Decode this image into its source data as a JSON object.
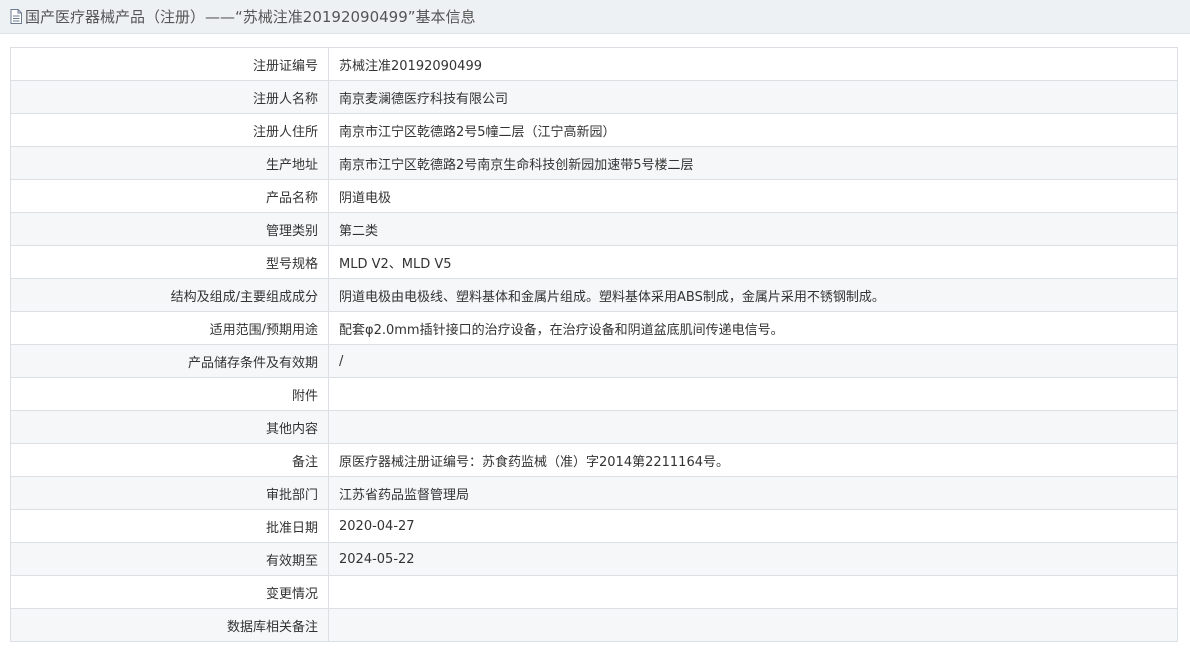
{
  "header": {
    "icon": "document-icon",
    "title": "国产医疗器械产品（注册）——“苏械注准20192090499”基本信息"
  },
  "rows": [
    {
      "label": "注册证编号",
      "value": "苏械注准20192090499"
    },
    {
      "label": "注册人名称",
      "value": "南京麦澜德医疗科技有限公司"
    },
    {
      "label": "注册人住所",
      "value": "南京市江宁区乾德路2号5幢二层（江宁高新园）"
    },
    {
      "label": "生产地址",
      "value": "南京市江宁区乾德路2号南京生命科技创新园加速带5号楼二层"
    },
    {
      "label": "产品名称",
      "value": "阴道电极"
    },
    {
      "label": "管理类别",
      "value": "第二类"
    },
    {
      "label": "型号规格",
      "value": "MLD V2、MLD V5"
    },
    {
      "label": "结构及组成/主要组成成分",
      "value": "阴道电极由电极线、塑料基体和金属片组成。塑料基体采用ABS制成，金属片采用不锈钢制成。"
    },
    {
      "label": "适用范围/预期用途",
      "value": "配套φ2.0mm插针接口的治疗设备，在治疗设备和阴道盆底肌间传递电信号。"
    },
    {
      "label": "产品储存条件及有效期",
      "value": "/"
    },
    {
      "label": "附件",
      "value": ""
    },
    {
      "label": "其他内容",
      "value": ""
    },
    {
      "label": "备注",
      "value": "原医疗器械注册证编号：苏食药监械（准）字2014第2211164号。"
    },
    {
      "label": "审批部门",
      "value": "江苏省药品监督管理局"
    },
    {
      "label": "批准日期",
      "value": "2020-04-27"
    },
    {
      "label": "有效期至",
      "value": "2024-05-22"
    },
    {
      "label": "变更情况",
      "value": ""
    },
    {
      "label": "数据库相关备注",
      "value": ""
    }
  ]
}
